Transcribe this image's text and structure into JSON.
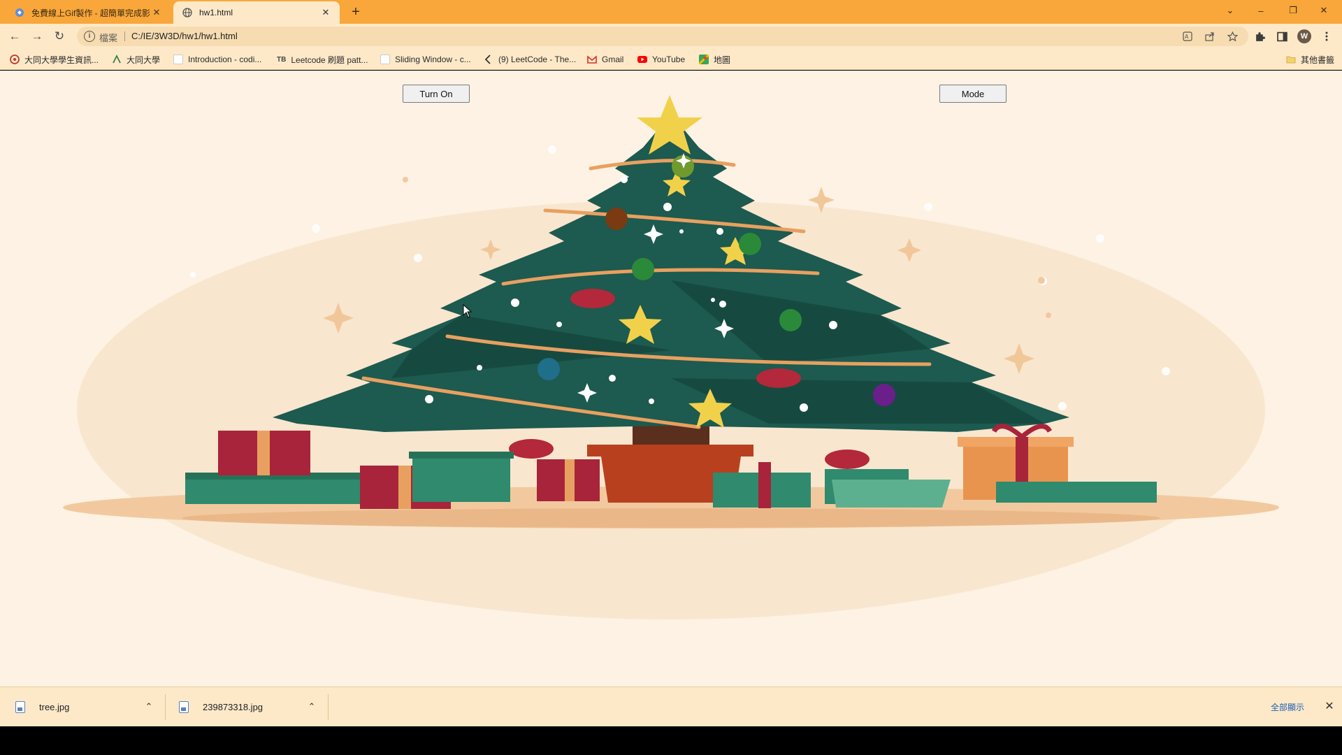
{
  "tabs": [
    {
      "title": "免費線上Gif製作 - 超簡單完成影",
      "close": "✕"
    },
    {
      "title": "hw1.html",
      "close": "✕"
    }
  ],
  "new_tab": "+",
  "window_controls": {
    "dropdown": "⌄",
    "minimize": "–",
    "restore": "❐",
    "close": "✕"
  },
  "toolbar": {
    "back": "←",
    "forward": "→",
    "reload": "↻"
  },
  "omnibox": {
    "info": "i",
    "scheme": "檔案",
    "url": "C:/IE/3W3D/hw1/hw1.html"
  },
  "avatar_letter": "W",
  "bookmarks": [
    {
      "label": "大同大學學生資訊...",
      "icon": "tatung-portal-icon",
      "color": "#c0392b"
    },
    {
      "label": "大同大學",
      "icon": "tatung-icon",
      "color": "#3a7d44"
    },
    {
      "label": "Introduction - codi...",
      "icon": "page-icon",
      "color": "#ffffff"
    },
    {
      "label": "Leetcode 刷題 patt...",
      "icon": "tb-icon",
      "color": "#444444"
    },
    {
      "label": "Sliding Window - c...",
      "icon": "page-icon",
      "color": "#ffffff"
    },
    {
      "label": "(9) LeetCode - The...",
      "icon": "leetcode-icon",
      "color": "#333333"
    },
    {
      "label": "Gmail",
      "icon": "gmail-icon",
      "color": "#d93025"
    },
    {
      "label": "YouTube",
      "icon": "youtube-icon",
      "color": "#ff0000"
    },
    {
      "label": "地圖",
      "icon": "maps-icon",
      "color": "#34a853"
    }
  ],
  "other_bookmarks": "其他書籤",
  "page": {
    "turn_on_button": "Turn On",
    "mode_button": "Mode"
  },
  "downloads": [
    {
      "name": "tree.jpg"
    },
    {
      "name": "239873318.jpg"
    }
  ],
  "show_all": "全部顯示",
  "colors": {
    "tab_strip": "#f9a73a",
    "toolbar": "#fde9c8",
    "page_bg": "#fdf2e3",
    "tree": "#1d5a4f",
    "garland": "#e8a060",
    "star": "#f2d14a",
    "ornament_red": "#b3283a"
  }
}
